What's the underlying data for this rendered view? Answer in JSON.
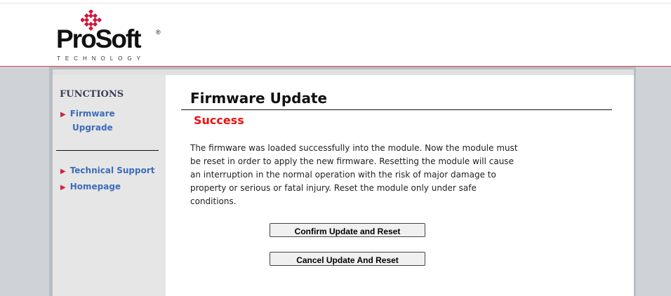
{
  "brand": {
    "name": "ProSoft",
    "registered": "®",
    "tagline": "TECHNOLOGY",
    "accent_color": "#cc2244",
    "logo_icon": "diamond-cluster-icon"
  },
  "sidebar": {
    "heading": "FUNCTIONS",
    "items": [
      {
        "label_line1": "Firmware",
        "label_line2": "Upgrade",
        "icon": "triangle-right-icon"
      },
      {
        "label": "Technical Support",
        "icon": "triangle-right-icon"
      },
      {
        "label": "Homepage",
        "icon": "triangle-right-icon"
      }
    ]
  },
  "main": {
    "title": "Firmware Update",
    "status": "Success",
    "status_color": "#ee1111",
    "message": "The firmware was loaded successfully into the module. Now the module must be reset in order to apply the new firmware. Resetting the module will cause an interruption in the normal operation with the risk of major damage to property or serious or fatal injury. Reset the module only under safe conditions.",
    "buttons": {
      "confirm": "Confirm Update and Reset",
      "cancel": "Cancel Update And Reset"
    }
  }
}
